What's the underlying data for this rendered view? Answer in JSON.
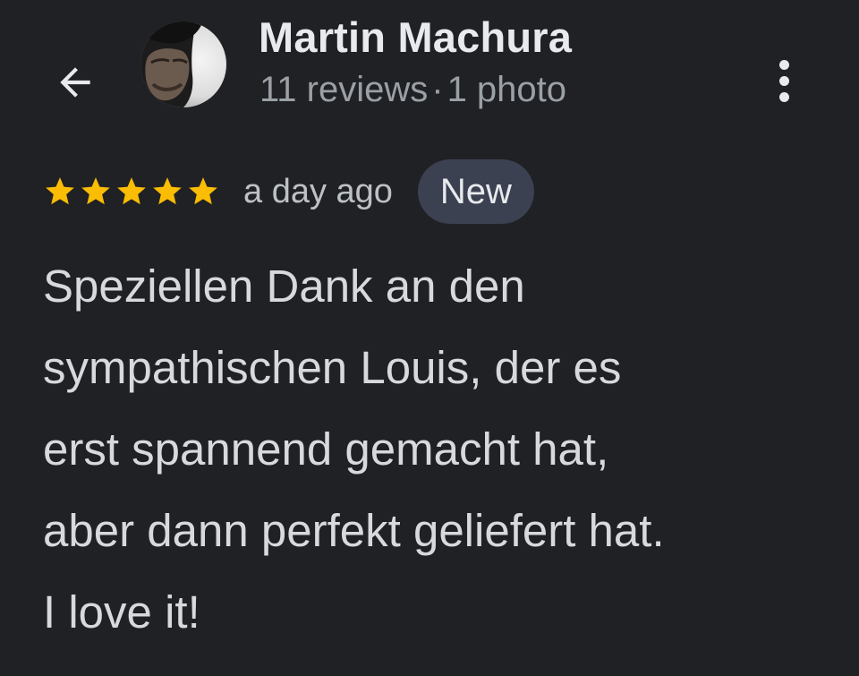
{
  "header": {
    "back_icon": "arrow-left-icon",
    "reviewer_name": "Martin Machura",
    "reviews_count": "11 reviews",
    "separator": "·",
    "photos_count": "1 photo",
    "more_icon": "more-vert-icon"
  },
  "review": {
    "rating": 5,
    "rating_max": 5,
    "star_color": "#fbbc04",
    "time": "a day ago",
    "badge": "New",
    "text_lines": [
      "Speziellen Dank an den",
      "sympathischen Louis, der es",
      "erst spannend gemacht hat,",
      "aber dann perfekt geliefert hat.",
      "I love it!"
    ]
  },
  "colors": {
    "background": "#202124",
    "primary_text": "#e8eaed",
    "secondary_text": "#9aa0a6",
    "badge_background": "#3c4152"
  }
}
